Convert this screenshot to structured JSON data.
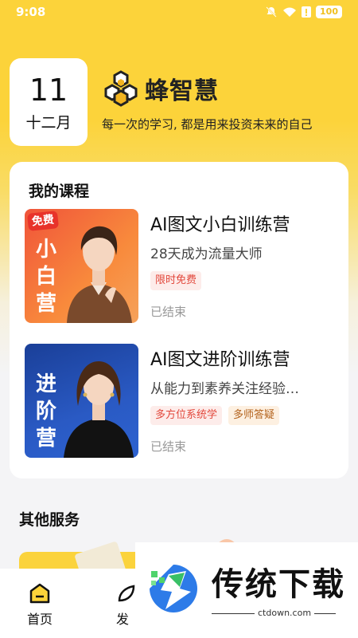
{
  "status_bar": {
    "time": "9:08",
    "battery": "100"
  },
  "date": {
    "day": "11",
    "month": "十二月"
  },
  "brand": {
    "name": "蜂智慧",
    "slogan": "每一次的学习, 都是用来投资未来的自己"
  },
  "my_courses": {
    "title": "我的课程",
    "items": [
      {
        "thumb_badge": "免费",
        "thumb_text": "小白营",
        "title": "AI图文小白训练营",
        "subtitle": "28天成为流量大师",
        "tags": [
          "限时免费"
        ],
        "status": "已结束"
      },
      {
        "thumb_badge": "",
        "thumb_text": "进阶营",
        "title": "AI图文进阶训练营",
        "subtitle": "从能力到素养关注经验…",
        "tags": [
          "多方位系统学",
          "多师答疑"
        ],
        "status": "已结束"
      }
    ]
  },
  "other_services": {
    "title": "其他服务"
  },
  "nav": {
    "home": "首页",
    "second": "发"
  },
  "watermark": {
    "text": "传统下载",
    "url": "ctdown.com"
  },
  "colors": {
    "accent": "#fcd33a",
    "tag_red": "#e2483c",
    "tag_orange": "#b3621c"
  }
}
